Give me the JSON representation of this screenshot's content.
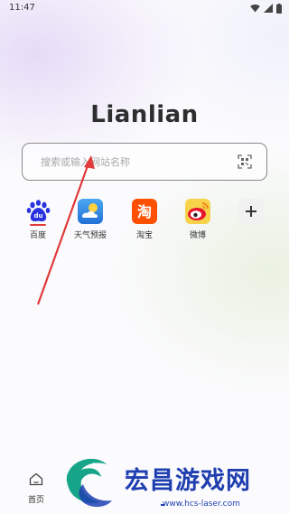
{
  "status_bar": {
    "time": "11:47",
    "icons": [
      "wifi-icon",
      "signal-icon",
      "battery-icon"
    ]
  },
  "app": {
    "logo_text": "Lianlian"
  },
  "search": {
    "placeholder": "搜索或输入网站名称",
    "value": "",
    "action_icon": "scan-icon"
  },
  "shortcuts": [
    {
      "label": "百度",
      "icon": "baidu-icon",
      "color": "#2932e1"
    },
    {
      "label": "天气预报",
      "icon": "weather-icon",
      "color": "#2f8de4"
    },
    {
      "label": "淘宝",
      "icon": "taobao-icon",
      "color": "#ff5000"
    },
    {
      "label": "微博",
      "icon": "weibo-icon",
      "color": "#e6162d"
    },
    {
      "label": "",
      "icon": "add-icon"
    }
  ],
  "bottom_nav": {
    "home_label": "首页",
    "home_icon": "home-icon"
  },
  "watermark": {
    "title": "宏昌游戏网",
    "url": "www.hcs-laser.com"
  },
  "colors": {
    "accent_annotation": "#e03a3a",
    "watermark": "#1f3fb0"
  }
}
